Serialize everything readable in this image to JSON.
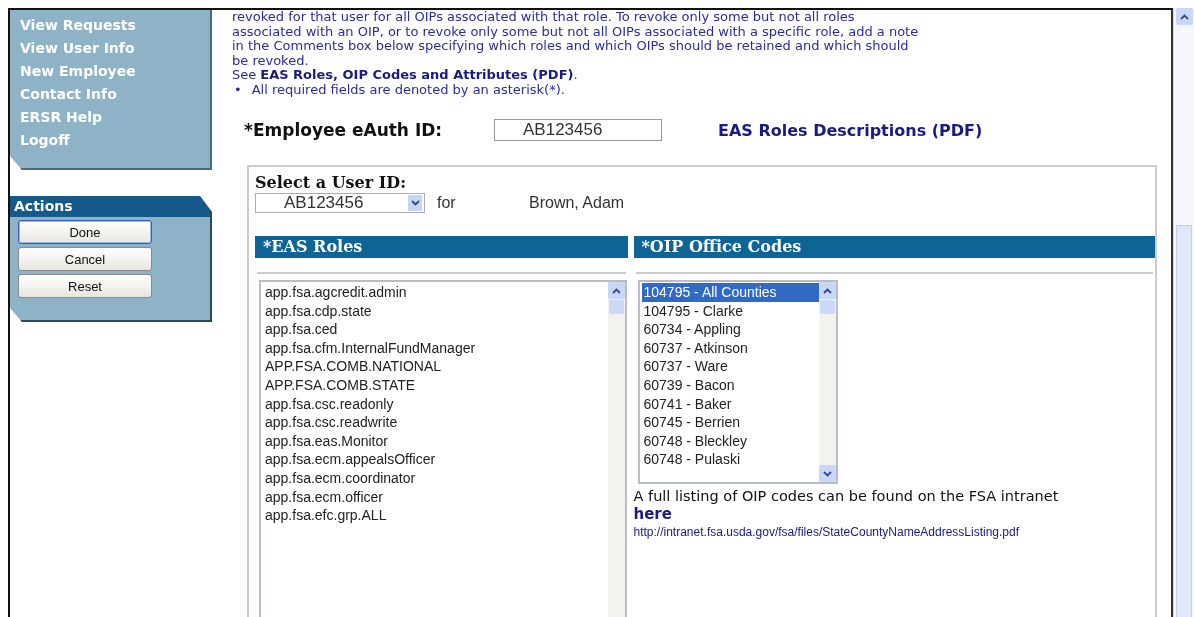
{
  "nav": {
    "items": [
      {
        "label": "View Requests"
      },
      {
        "label": "View User Info"
      },
      {
        "label": "New Employee"
      },
      {
        "label": "Contact Info"
      },
      {
        "label": "ERSR Help"
      },
      {
        "label": "Logoff"
      }
    ]
  },
  "actions": {
    "title": "Actions",
    "buttons": [
      {
        "label": "Done",
        "focused": true
      },
      {
        "label": "Cancel",
        "focused": false
      },
      {
        "label": "Reset",
        "focused": false
      }
    ]
  },
  "intro": {
    "lines": [
      "revoked for that user for all OIPs associated with that role. To revoke only some but not all roles",
      "associated with an OIP, or to revoke only some but not all OIPs associated with a specific role, add a note",
      "in the Comments box below specifying which roles and which OIPs should be retained and which should",
      "be revoked."
    ],
    "see_prefix": "See",
    "see_link": "EAS Roles, OIP Codes and Attributes (PDF)",
    "see_suffix": ".",
    "bullet": "•",
    "note": "All required fields are denoted by an asterisk(*)."
  },
  "employee": {
    "label": "*Employee eAuth ID:",
    "value": "AB123456",
    "link": "EAS Roles Descriptions (PDF)"
  },
  "user_select": {
    "label": "Select a User ID:",
    "value": "AB123456",
    "for": "for",
    "name": "Brown, Adam"
  },
  "roles": {
    "heading": "*EAS Roles",
    "items": [
      {
        "label": "app.fsa.agcredit.admin",
        "selected": false
      },
      {
        "label": "app.fsa.cdp.state",
        "selected": false
      },
      {
        "label": "app.fsa.ced",
        "selected": false
      },
      {
        "label": "app.fsa.cfm.InternalFundManager",
        "selected": false
      },
      {
        "label": "APP.FSA.COMB.NATIONAL",
        "selected": false
      },
      {
        "label": "APP.FSA.COMB.STATE",
        "selected": false
      },
      {
        "label": "app.fsa.csc.readonly",
        "selected": false
      },
      {
        "label": "app.fsa.csc.readwrite",
        "selected": false
      },
      {
        "label": "app.fsa.eas.Monitor",
        "selected": false
      },
      {
        "label": "app.fsa.ecm.appealsOfficer",
        "selected": false
      },
      {
        "label": "app.fsa.ecm.coordinator",
        "selected": false
      },
      {
        "label": "app.fsa.ecm.officer",
        "selected": false
      },
      {
        "label": "app.fsa.efc.grp.ALL",
        "selected": false
      }
    ]
  },
  "offices": {
    "heading": "*OIP Office Codes",
    "items": [
      {
        "label": "104795 - All Counties",
        "selected": true
      },
      {
        "label": "104795 - Clarke",
        "selected": false
      },
      {
        "label": "60734 - Appling",
        "selected": false
      },
      {
        "label": "60737 - Atkinson",
        "selected": false
      },
      {
        "label": "60737 - Ware",
        "selected": false
      },
      {
        "label": "60739 - Bacon",
        "selected": false
      },
      {
        "label": "60741 - Baker",
        "selected": false
      },
      {
        "label": "60745 - Berrien",
        "selected": false
      },
      {
        "label": "60748 - Bleckley",
        "selected": false
      },
      {
        "label": "60748 - Pulaski",
        "selected": false
      }
    ],
    "note": "A full listing of OIP codes can be found on the FSA intranet",
    "here": "here",
    "url": "http://intranet.fsa.usda.gov/fsa/files/StateCountyNameAddressListing.pdf"
  }
}
